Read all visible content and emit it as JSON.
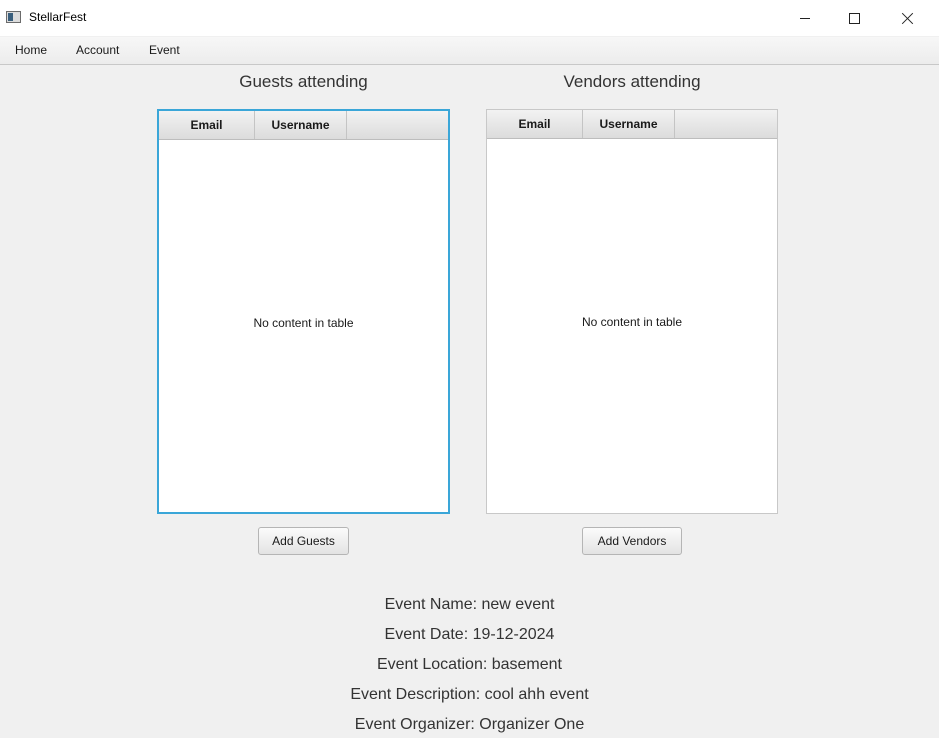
{
  "window": {
    "title": "StellarFest",
    "controls": {
      "minimize_icon": "minimize-icon",
      "maximize_icon": "maximize-icon",
      "close_icon": "close-icon"
    }
  },
  "menubar": {
    "items": [
      {
        "label": "Home"
      },
      {
        "label": "Account"
      },
      {
        "label": "Event"
      }
    ]
  },
  "guests": {
    "title": "Guests attending",
    "columns": [
      "Email",
      "Username"
    ],
    "rows": [],
    "empty_text": "No content in table",
    "button_label": "Add Guests",
    "focused": true
  },
  "vendors": {
    "title": "Vendors attending",
    "columns": [
      "Email",
      "Username"
    ],
    "rows": [],
    "empty_text": "No content in table",
    "button_label": "Add Vendors"
  },
  "event": {
    "name_line": "Event Name: new event",
    "date_line": "Event Date: 19-12-2024",
    "location_line": "Event Location: basement",
    "description_line": "Event Description: cool ahh event",
    "organizer_line": "Event Organizer: Organizer One"
  },
  "colors": {
    "focus_border": "#3aa6d8",
    "background": "#f0f0f0"
  }
}
